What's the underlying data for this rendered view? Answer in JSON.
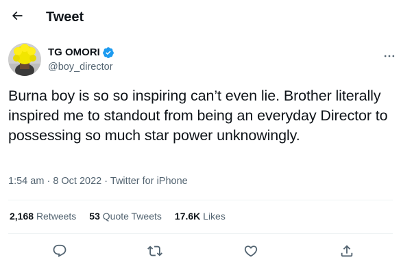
{
  "header": {
    "title": "Tweet",
    "back_icon": "arrow-left-icon"
  },
  "author": {
    "display_name": "TG OMORI",
    "handle": "@boy_director",
    "verified": true,
    "verified_color": "#1d9bf0",
    "more_icon": "more-horizontal-icon"
  },
  "tweet": {
    "text": "Burna boy is so so inspiring can’t even lie. Brother literally inspired me to standout from being an everyday Director to possessing so much star power unknowingly.",
    "time": "1:54 am",
    "separator": "·",
    "date": "8 Oct 2022",
    "source": "Twitter for iPhone"
  },
  "stats": {
    "retweets_count": "2,168",
    "retweets_label": "Retweets",
    "quotes_count": "53",
    "quotes_label": "Quote Tweets",
    "likes_count": "17.6K",
    "likes_label": "Likes"
  },
  "actions": [
    "reply-icon",
    "retweet-icon",
    "like-icon",
    "share-icon"
  ],
  "colors": {
    "text": "#0f1419",
    "secondary": "#536471",
    "divider": "#eff3f4",
    "accent": "#1d9bf0"
  }
}
